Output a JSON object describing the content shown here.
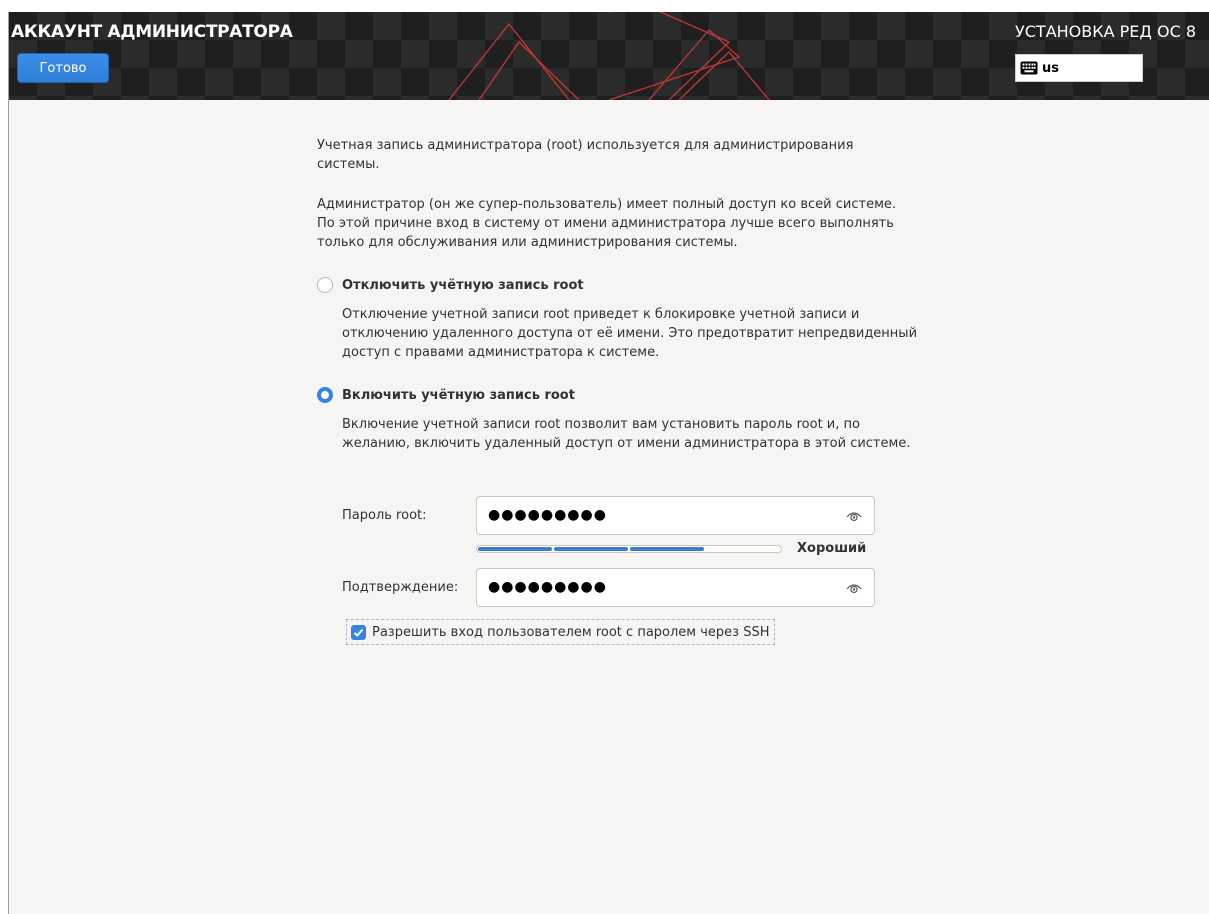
{
  "header": {
    "spoke_title": "АККАУНТ АДМИНИСТРАТОРА",
    "done_label": "Готово",
    "product_title": "УСТАНОВКА РЕД ОС 8",
    "keyboard_layout": "us",
    "keyboard_icon": "keyboard-icon",
    "accent_color": "#3584e4"
  },
  "intro": {
    "p1": "Учетная запись администратора (root) используется для администрирования системы.",
    "p2": "Администратор (он же супер-пользователь) имеет полный доступ ко всей системе. По этой причине вход в систему от имени администратора лучше всего выполнять только для обслуживания или администрирования системы."
  },
  "options": {
    "disable": {
      "label": "Отключить учётную запись root",
      "description": "Отключение учетной записи root приведет к блокировке учетной записи и отключению удаленного доступа от её имени. Это предотвратит непредвиденный доступ с правами администратора к системе.",
      "selected": false
    },
    "enable": {
      "label": "Включить учётную запись root",
      "description": "Включение учетной записи root позволит вам установить пароль root и, по желанию, включить удаленный доступ от имени администратора в этой системе.",
      "selected": true
    }
  },
  "form": {
    "password_label": "Пароль root:",
    "password_value": "●●●●●●●●●",
    "confirm_label": "Подтверждение:",
    "confirm_value": "●●●●●●●●●",
    "show_password_icon": "eye-icon",
    "strength_fraction": 0.75,
    "strength_label": "Хороший",
    "ssh_checkbox_label": "Разрешить вход пользователем root с паролем через SSH",
    "ssh_checked": true
  }
}
